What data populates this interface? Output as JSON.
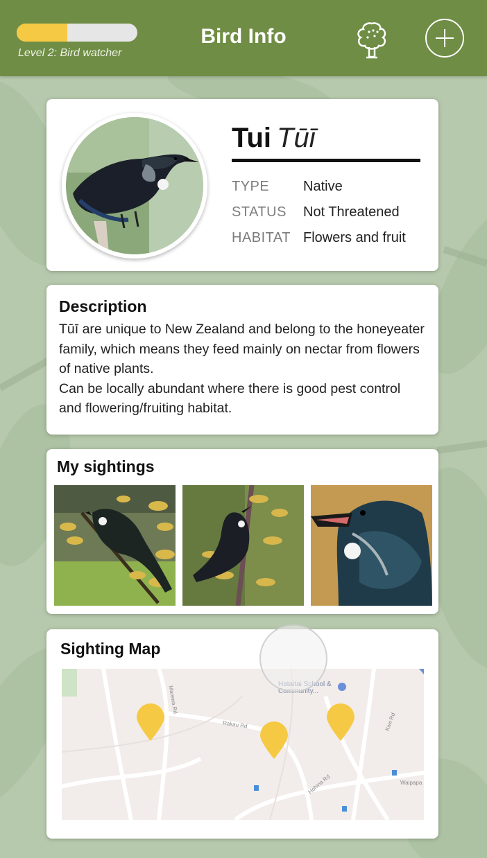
{
  "header": {
    "title": "Bird Info",
    "level_label": "Level 2: Bird watcher",
    "progress_fraction": 0.42,
    "accent_color": "#6f8d44",
    "progress_color": "#f6c945",
    "tree_icon": "tree-icon",
    "add_icon": "plus-circle-icon"
  },
  "bird": {
    "name": "Tui",
    "maori_name": "Tūī",
    "fields": [
      {
        "key": "TYPE",
        "value": "Native"
      },
      {
        "key": "STATUS",
        "value": "Not Threatened"
      },
      {
        "key": "HABITAT",
        "value": "Flowers and fruit"
      }
    ]
  },
  "description": {
    "title": "Description",
    "paragraphs": [
      "Tūī are unique to New Zealand and belong to the honeyeater family, which means they feed mainly on nectar from flowers of native plants.",
      "Can be locally abundant where there is good pest control and flowering/fruiting habitat."
    ]
  },
  "sightings": {
    "title": "My sightings",
    "photo_count": 3
  },
  "map": {
    "title": "Sighting Map",
    "poi_label": "Hataitai School & Community...",
    "road_labels": [
      "Rakau Rd",
      "Marewa Rd",
      "Waipapa",
      "Hohiria Rd",
      "Kiwi Rd"
    ],
    "pin_color": "#f6c945",
    "pin_count": 3
  }
}
